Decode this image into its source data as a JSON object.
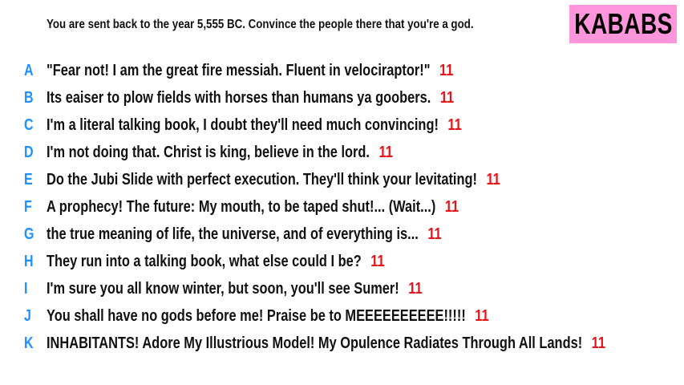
{
  "prompt": "You are sent back to the year 5,555 BC. Convince the people there that you're a god.",
  "badge": {
    "label": "KABABS",
    "color": "#ff96dc"
  },
  "colors": {
    "letter": "#1e90ff",
    "score": "#e4151a"
  },
  "answers": [
    {
      "letter": "A",
      "text": "\"Fear not! I am the great fire messiah. Fluent in velociraptor!\"",
      "score": "11"
    },
    {
      "letter": "B",
      "text": "Its eaiser to plow fields with horses than humans ya goobers.",
      "score": "11"
    },
    {
      "letter": "C",
      "text": "I'm a literal talking book, I doubt they'll need much convincing!",
      "score": "11"
    },
    {
      "letter": "D",
      "text": "I'm not doing that. Christ is king, believe in the lord.",
      "score": "11"
    },
    {
      "letter": "E",
      "text": "Do the Jubi Slide with perfect execution. They'll think your levitating!",
      "score": "11"
    },
    {
      "letter": "F",
      "text": "A prophecy!  The future: My mouth, to be taped shut!... (Wait...)",
      "score": "11"
    },
    {
      "letter": "G",
      "text": "the true meaning of life, the universe, and of everything is...",
      "score": "11"
    },
    {
      "letter": "H",
      "text": "They run into a talking book, what else could I be?",
      "score": "11"
    },
    {
      "letter": "I",
      "text": "I'm sure you all know winter, but soon, you'll see Sumer!",
      "score": "11"
    },
    {
      "letter": "J",
      "text": "You shall have no gods before me! Praise be to MEEEEEEEEEE!!!!!",
      "score": "11"
    },
    {
      "letter": "K",
      "text": "INHABITANTS! Adore My Illustrious Model! My Opulence Radiates Through All Lands!",
      "score": "11"
    }
  ]
}
